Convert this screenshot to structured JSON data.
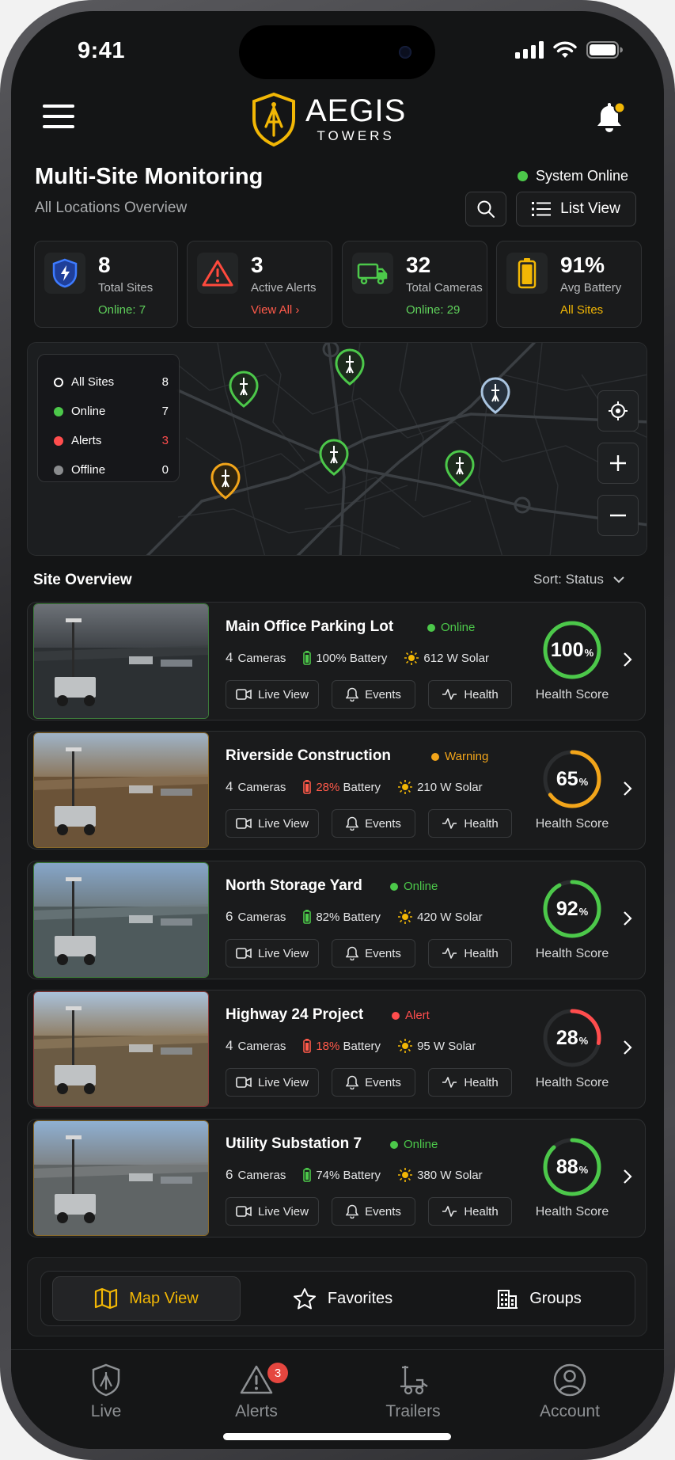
{
  "status_bar": {
    "time": "9:41"
  },
  "brand": {
    "name": "AEGIS",
    "sub": "TOWERS",
    "accent": "#f2b705"
  },
  "header": {
    "title": "Multi-Site Monitoring",
    "subtitle": "All Locations Overview",
    "system_status": "System Online",
    "list_view_label": "List View"
  },
  "stats": [
    {
      "value": "8",
      "label": "Total Sites",
      "sub": "Online: 7",
      "sub_color": "#5fd05b",
      "icon": "shield-bolt-icon"
    },
    {
      "value": "3",
      "label": "Active Alerts",
      "sub": "View All ›",
      "sub_color": "#ff5a4a",
      "icon": "warning-icon"
    },
    {
      "value": "32",
      "label": "Total Cameras",
      "sub": "Online: 29",
      "sub_color": "#5fd05b",
      "icon": "camera-trailer-icon"
    },
    {
      "value": "91%",
      "label": "Avg Battery",
      "sub": "All Sites",
      "sub_color": "#f2b705",
      "icon": "battery-icon"
    }
  ],
  "legend": [
    {
      "label": "All Sites",
      "count": "8",
      "color": "#ffffff",
      "hollow": true
    },
    {
      "label": "Online",
      "count": "7",
      "color": "#4cc84a"
    },
    {
      "label": "Alerts",
      "count": "3",
      "color": "#ff4d4d",
      "count_color": "#ff4d4d"
    },
    {
      "label": "Offline",
      "count": "0",
      "color": "#8a8c8e"
    }
  ],
  "section": {
    "title": "Site Overview",
    "sort": "Sort: Status"
  },
  "sites": [
    {
      "name": "Main Office Parking Lot",
      "status": "Online",
      "status_color": "#4cc84a",
      "cameras": "4",
      "cameras_label": "Cameras",
      "battery": "100%",
      "battery_color": "#e3e4e5",
      "battery_icon_color": "#4cc84a",
      "battery_label": "Battery",
      "solar": "612 W Solar",
      "score": 100,
      "score_color": "#4cc84a",
      "score_label": "Health Score",
      "border": "#3c7a3a"
    },
    {
      "name": "Riverside Construction",
      "status": "Warning",
      "status_color": "#f2a51a",
      "cameras": "4",
      "cameras_label": "Cameras",
      "battery": "28%",
      "battery_color": "#ff5a4a",
      "battery_icon_color": "#ff5a4a",
      "battery_label": "Battery",
      "solar": "210 W Solar",
      "score": 65,
      "score_color": "#f2a51a",
      "score_label": "Health Score",
      "border": "#8a6a2a"
    },
    {
      "name": "North Storage Yard",
      "status": "Online",
      "status_color": "#4cc84a",
      "cameras": "6",
      "cameras_label": "Cameras",
      "battery": "82%",
      "battery_color": "#e3e4e5",
      "battery_icon_color": "#4cc84a",
      "battery_label": "Battery",
      "solar": "420 W Solar",
      "score": 92,
      "score_color": "#4cc84a",
      "score_label": "Health Score",
      "border": "#3c7a3a"
    },
    {
      "name": "Highway 24 Project",
      "status": "Alert",
      "status_color": "#ff4d4d",
      "cameras": "4",
      "cameras_label": "Cameras",
      "battery": "18%",
      "battery_color": "#ff5a4a",
      "battery_icon_color": "#ff5a4a",
      "battery_label": "Battery",
      "solar": "95 W Solar",
      "score": 28,
      "score_color": "#ff4d4d",
      "score_label": "Health Score",
      "border": "#8a3a3a"
    },
    {
      "name": "Utility Substation 7",
      "status": "Online",
      "status_color": "#4cc84a",
      "cameras": "6",
      "cameras_label": "Cameras",
      "battery": "74%",
      "battery_color": "#e3e4e5",
      "battery_icon_color": "#4cc84a",
      "battery_label": "Battery",
      "solar": "380 W Solar",
      "score": 88,
      "score_color": "#4cc84a",
      "score_label": "Health Score",
      "border": "#8a6a2a"
    }
  ],
  "actions": {
    "live": "Live View",
    "events": "Events",
    "health": "Health"
  },
  "segments": [
    {
      "label": "Map View",
      "icon": "map-icon",
      "active": true
    },
    {
      "label": "Favorites",
      "icon": "star-icon"
    },
    {
      "label": "Groups",
      "icon": "building-icon"
    }
  ],
  "tabs": [
    {
      "label": "Live",
      "icon": "shield-icon"
    },
    {
      "label": "Alerts",
      "icon": "alert-triangle-icon",
      "badge": "3"
    },
    {
      "label": "Trailers",
      "icon": "trailer-icon"
    },
    {
      "label": "Account",
      "icon": "user-circle-icon"
    }
  ]
}
